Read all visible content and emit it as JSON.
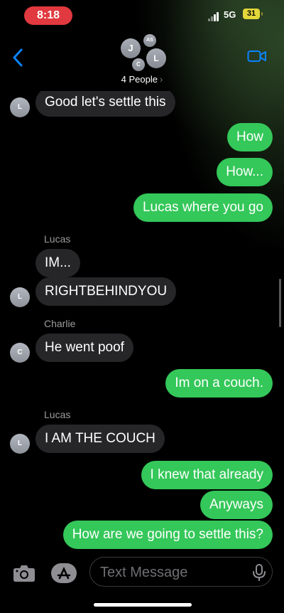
{
  "status_bar": {
    "time": "8:18",
    "network": "5G",
    "battery": "31"
  },
  "header": {
    "avatars": [
      "J",
      "AS",
      "L",
      "C"
    ],
    "group_name": "4 People",
    "chevron": "›"
  },
  "messages": [
    {
      "type": "received",
      "avatar": "L",
      "text": "Good let's settle this"
    },
    {
      "type": "sent",
      "text": "How"
    },
    {
      "type": "sent",
      "text": "How..."
    },
    {
      "type": "sent",
      "text": "Lucas where you go"
    },
    {
      "type": "sender",
      "text": "Lucas"
    },
    {
      "type": "received",
      "text": "IM..."
    },
    {
      "type": "received",
      "avatar": "L",
      "text": "RIGHTBEHINDYOU"
    },
    {
      "type": "sender",
      "text": "Charlie"
    },
    {
      "type": "received",
      "avatar": "C",
      "text": "He went poof"
    },
    {
      "type": "sent",
      "text": "Im on a couch."
    },
    {
      "type": "sender",
      "text": "Lucas"
    },
    {
      "type": "received",
      "avatar": "L",
      "text": "I AM THE COUCH"
    },
    {
      "type": "sent",
      "text": "I knew that already"
    },
    {
      "type": "sent",
      "text": "Anyways"
    },
    {
      "type": "sent",
      "text": "How are we going to settle this?"
    }
  ],
  "input": {
    "placeholder": "Text Message"
  },
  "icons": {
    "back": "chevron-left-icon",
    "video": "video-camera-icon",
    "camera": "camera-icon",
    "apps": "app-store-icon",
    "mic": "microphone-icon"
  },
  "colors": {
    "sent": "#34c759",
    "received": "#262629",
    "accent": "#0a84ff",
    "time_pill": "#e0393f"
  }
}
